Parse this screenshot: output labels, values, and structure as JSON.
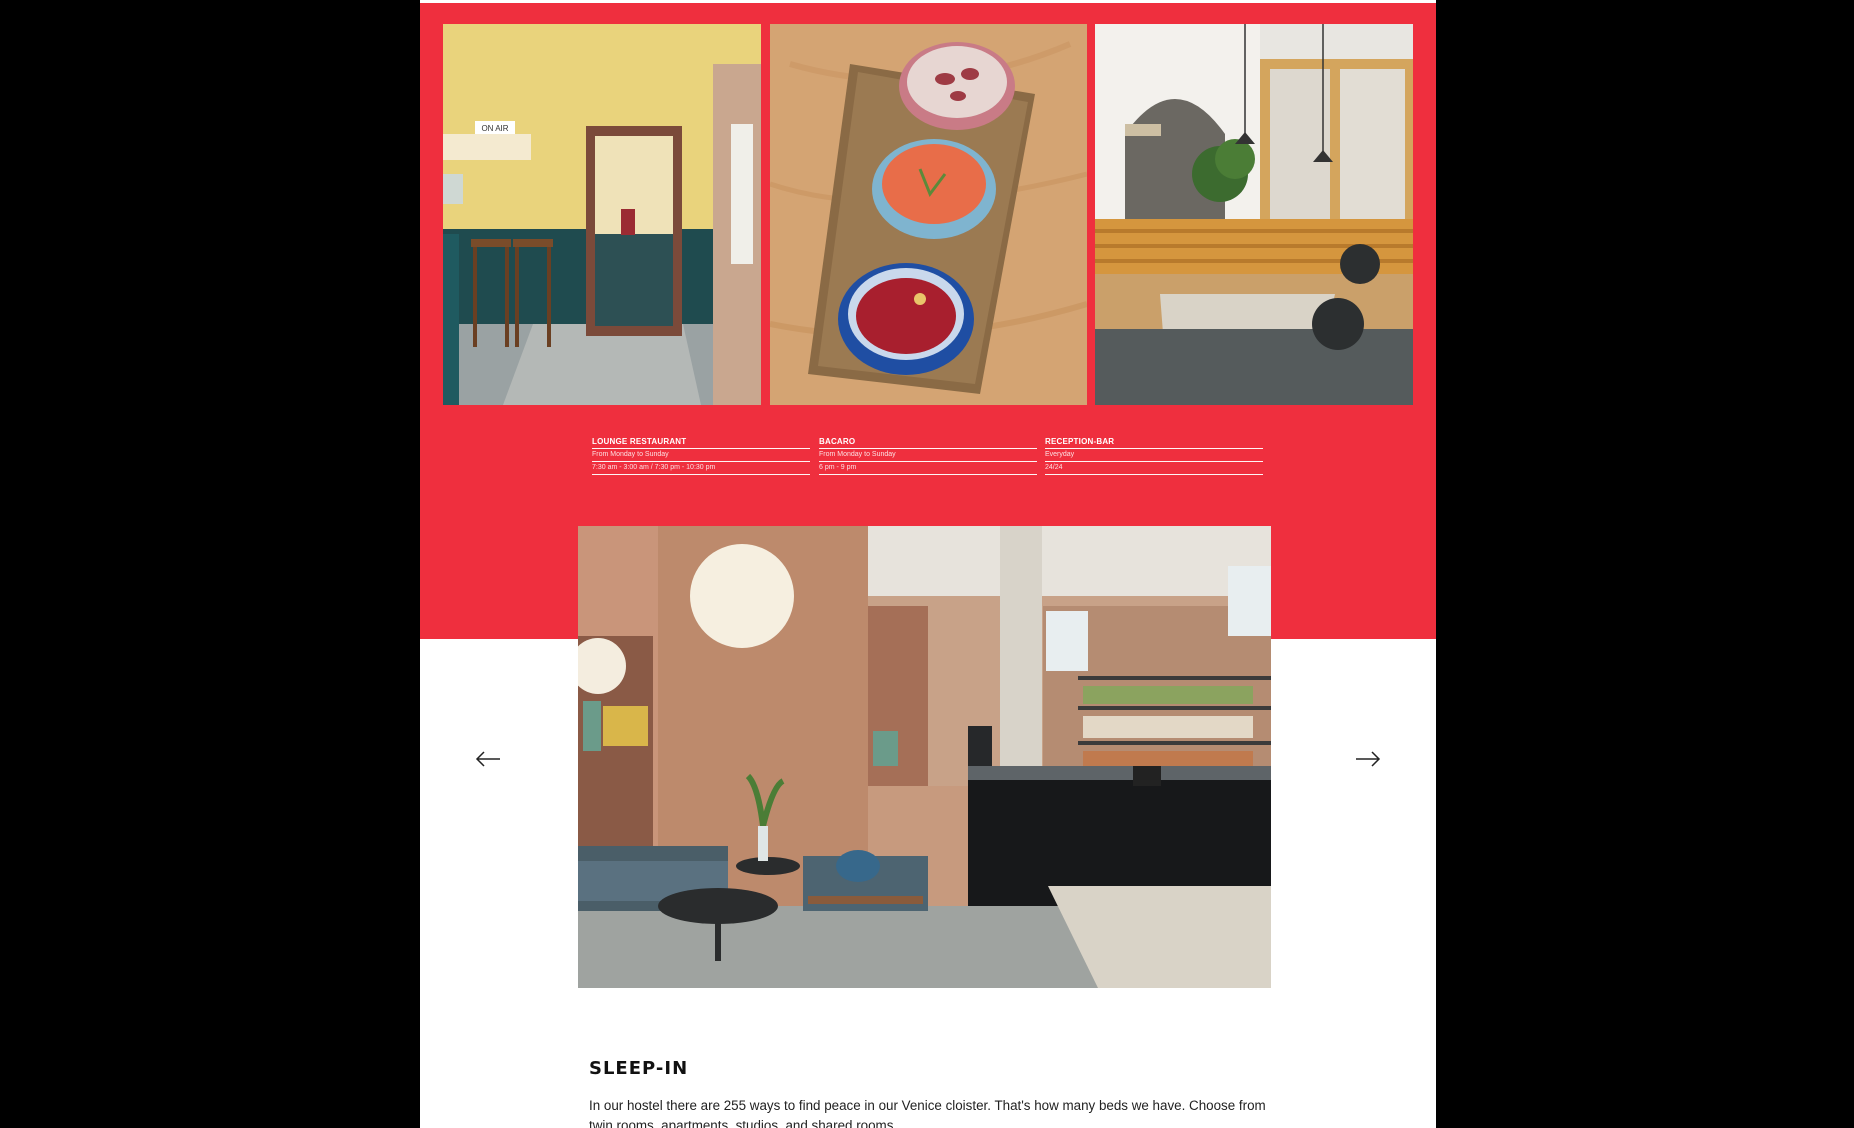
{
  "colors": {
    "accent": "#ef2f3e",
    "page_background": "#ffffff",
    "letterbox": "#000000"
  },
  "gallery": {
    "images": [
      {
        "name": "bar-corner-photo",
        "sign_text": "ON AIR"
      },
      {
        "name": "bacaro-bowls-photo"
      },
      {
        "name": "cafe-booth-photo"
      }
    ]
  },
  "hours": [
    {
      "title": "LOUNGE RESTAURANT",
      "rows": [
        "From Monday to Sunday",
        "7:30 am - 3:00 am / 7:30 pm - 10:30 pm"
      ]
    },
    {
      "title": "BACARO",
      "rows": [
        "From Monday to Sunday",
        "6 pm - 9 pm"
      ]
    },
    {
      "title": "RECEPTION-BAR",
      "rows": [
        "Everyday",
        "24/24"
      ]
    }
  ],
  "carousel": {
    "image": "lounge-hall-photo",
    "prev_icon": "arrow-left-icon",
    "next_icon": "arrow-right-icon"
  },
  "sleep_in": {
    "title": "SLEEP-IN",
    "body": "In our hostel there are 255 ways to find peace in our Venice cloister. That's how many beds we have. Choose from twin rooms, apartments, studios, and shared rooms."
  }
}
